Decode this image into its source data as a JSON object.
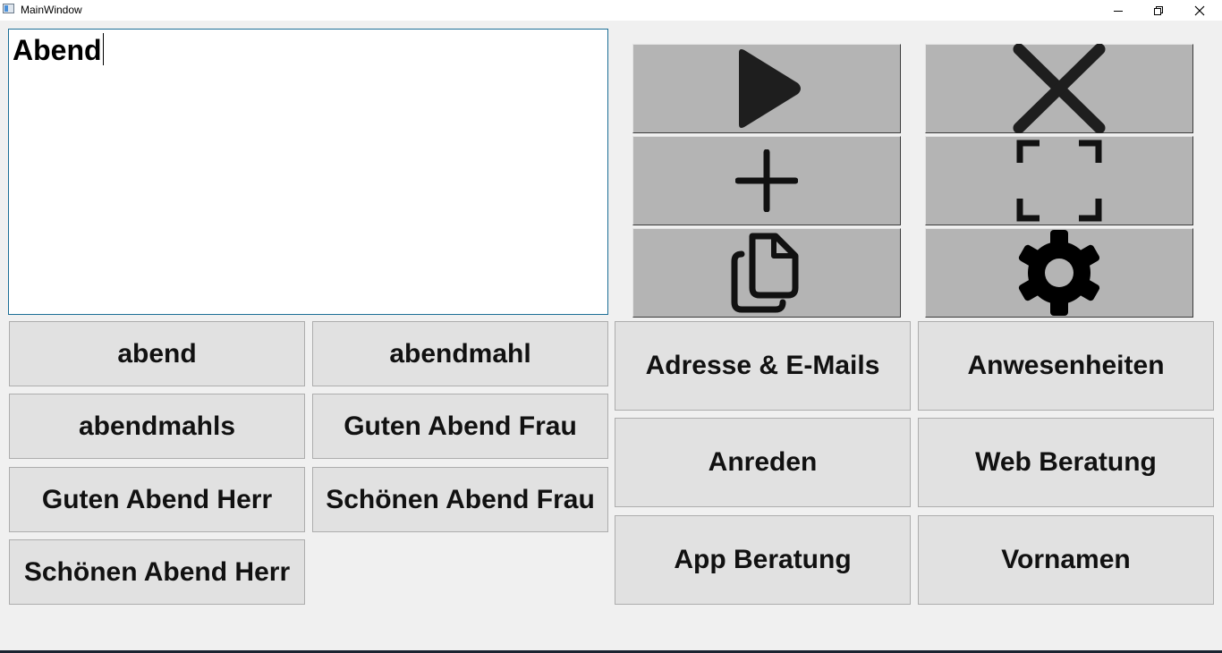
{
  "window": {
    "title": "MainWindow"
  },
  "editor": {
    "text": "Abend"
  },
  "suggestions": [
    "abend",
    "abendmahl",
    "abendmahls",
    "Guten Abend Frau",
    "Guten Abend Herr",
    "Schönen Abend Frau",
    "Schönen Abend Herr"
  ],
  "categories": [
    "Adresse & E-Mails",
    "Anwesenheiten",
    "Anreden",
    "Web Beratung",
    "App Beratung",
    "Vornamen"
  ],
  "toolbar": {
    "icons": [
      "play-icon",
      "close-x-icon",
      "plus-icon",
      "fullscreen-icon",
      "copy-files-icon",
      "gear-icon"
    ]
  },
  "colors": {
    "background": "#f0f0f0",
    "icon_button": "#b4b4b4",
    "word_button": "#e1e1e1",
    "editor_border": "#1c6e96",
    "icon_fill": "#1e1e1e"
  }
}
